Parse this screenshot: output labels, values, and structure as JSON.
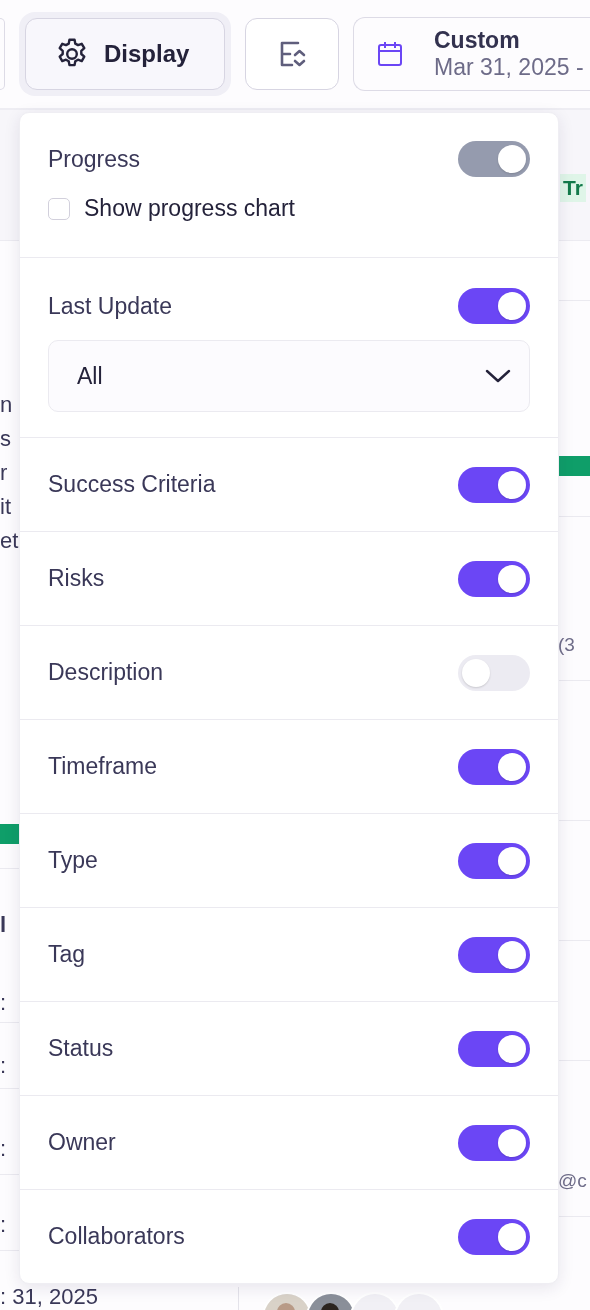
{
  "toolbar": {
    "display_button": {
      "label": "Display",
      "selected": true
    },
    "date_range": {
      "title": "Custom",
      "range": "Mar 31, 2025 -"
    }
  },
  "background": {
    "left_texts": [
      "n",
      "s",
      "r",
      "it",
      "et"
    ],
    "left_labels": [
      "l",
      ":",
      ":",
      ":",
      ":",
      ": 31, 2025"
    ],
    "tag": "Tr",
    "right_texts": [
      "(3",
      "@c"
    ],
    "avatars": [
      {
        "kind": "picture"
      },
      {
        "kind": "picture"
      },
      {
        "kind": "blank"
      },
      {
        "kind": "blank"
      }
    ]
  },
  "display_menu": {
    "sections": [
      {
        "label": "Progress",
        "on": true,
        "disabled": true,
        "checkbox": {
          "label": "Show progress chart",
          "checked": false
        }
      },
      {
        "label": "Last Update",
        "on": true,
        "disabled": false,
        "select": {
          "value": "All"
        }
      },
      {
        "label": "Success Criteria",
        "on": true,
        "disabled": false
      },
      {
        "label": "Risks",
        "on": true,
        "disabled": false
      },
      {
        "label": "Description",
        "on": false,
        "disabled": false
      },
      {
        "label": "Timeframe",
        "on": true,
        "disabled": false
      },
      {
        "label": "Type",
        "on": true,
        "disabled": false
      },
      {
        "label": "Tag",
        "on": true,
        "disabled": false
      },
      {
        "label": "Status",
        "on": true,
        "disabled": false
      },
      {
        "label": "Owner",
        "on": true,
        "disabled": false
      },
      {
        "label": "Collaborators",
        "on": true,
        "disabled": false
      }
    ]
  }
}
